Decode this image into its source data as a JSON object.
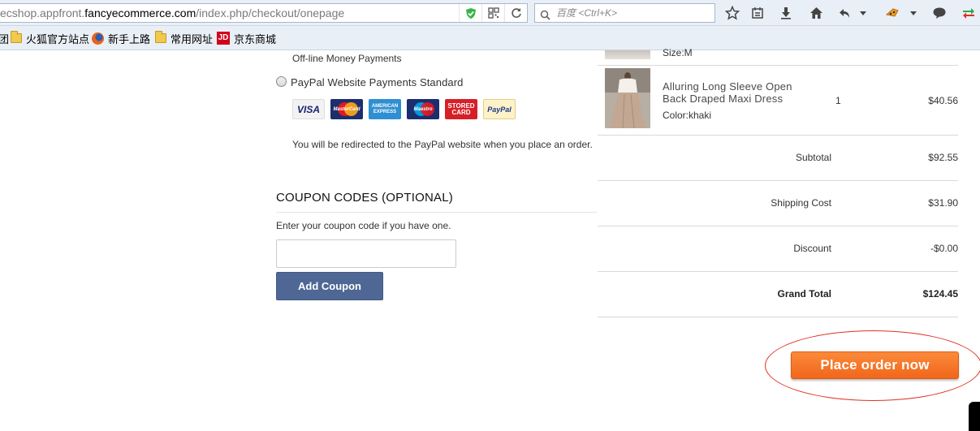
{
  "browser": {
    "url_prefix": "ecshop.appfront.",
    "url_domain": "fancyecommerce.com",
    "url_path": "/index.php/checkout/onepage",
    "search_placeholder": "百度 <Ctrl+K>"
  },
  "bookmarks": [
    {
      "label": "火狐官方站点",
      "icon": "folder-icon"
    },
    {
      "label": "新手上路",
      "icon": "firefox-icon"
    },
    {
      "label": "常用网址",
      "icon": "folder-icon"
    },
    {
      "label": "京东商城",
      "icon": "jd-icon"
    }
  ],
  "bookmarks_left_fragment": "团",
  "payment": {
    "offline_text": "Off-line Money Payments",
    "paypal_label": "PayPal Website Payments Standard",
    "cards": [
      "VISA",
      "MasterCard",
      "AMERICAN EXPRESS",
      "Maestro",
      "STORED CARD",
      "PayPal"
    ],
    "redirect_text": "You will be redirected to the PayPal website when you place an order."
  },
  "coupon": {
    "heading": "COUPON CODES (OPTIONAL)",
    "help": "Enter your coupon code if you have one.",
    "input_value": "",
    "button_label": "Add Coupon"
  },
  "order": {
    "prev_item_size": "Size:M",
    "item": {
      "name": "Alluring Long Sleeve Open Back Draped Maxi Dress",
      "color": "Color:khaki",
      "qty": "1",
      "price": "$40.56"
    },
    "subtotal_label": "Subtotal",
    "subtotal": "$92.55",
    "shipping_label": "Shipping Cost",
    "shipping": "$31.90",
    "discount_label": "Discount",
    "discount": "-$0.00",
    "grand_total_label": "Grand Total",
    "grand_total": "$124.45",
    "place_order_label": "Place order now"
  },
  "colors": {
    "place_order": "#f47424",
    "coupon_button": "#4f6794",
    "annotation_ellipse": "#e0311f"
  }
}
